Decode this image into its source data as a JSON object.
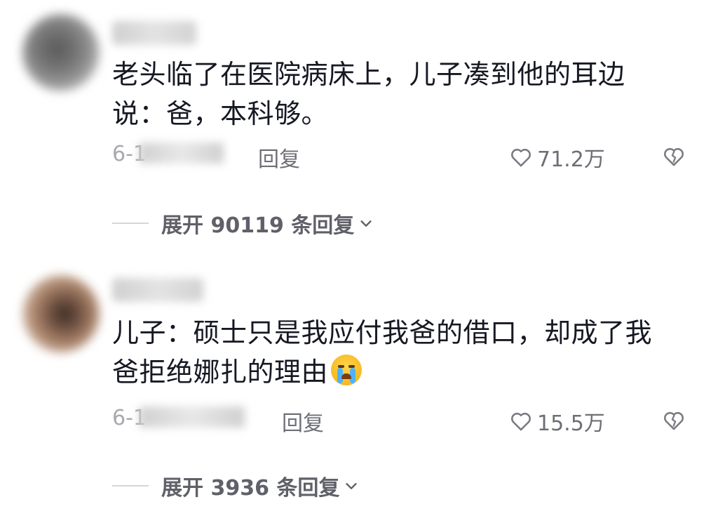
{
  "comments": [
    {
      "text_line1": "老头临了在医院病床上，儿子凑到他的耳边",
      "text_line2": "说：爸，本科够。",
      "date": "6-1",
      "reply_label": "回复",
      "likes": "71.2万",
      "expand_label": "展开 90119 条回复"
    },
    {
      "text_line1": "儿子：硕士只是我应付我爸的借口，却成了我",
      "text_line2": "爸拒绝娜扎的理由",
      "emoji": "loudly-crying-face",
      "date": "6-1",
      "reply_label": "回复",
      "likes": "15.5万",
      "expand_label": "展开 3936 条回复"
    }
  ],
  "icons": {
    "like": "heart-outline-icon",
    "dislike": "broken-heart-icon",
    "expand": "chevron-down-icon"
  },
  "colors": {
    "text": "#161823",
    "meta": "#a8a8ad",
    "action": "#6e6f76"
  }
}
